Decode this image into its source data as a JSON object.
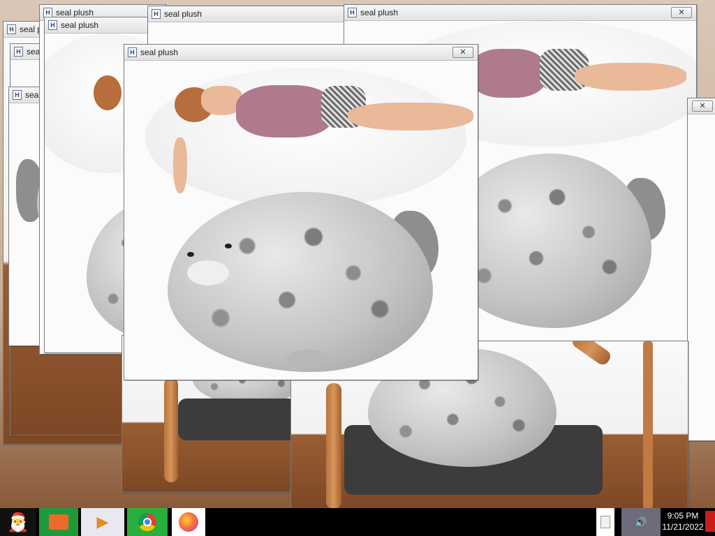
{
  "windows": [
    {
      "title": "seal plush",
      "close": "✕"
    },
    {
      "title": "seal plush",
      "close": "✕"
    },
    {
      "title": "seal plush",
      "close": "✕"
    },
    {
      "title": "seal plush",
      "close": "✕"
    },
    {
      "title": "seal plush",
      "close": "✕"
    },
    {
      "title": "seal plush",
      "close": "✕"
    },
    {
      "title": "seal plush",
      "close": "✕"
    },
    {
      "title": "seal plush",
      "close": "✕"
    },
    {
      "title": "seal plush",
      "close": "✕"
    }
  ],
  "app_icon_letter": "H",
  "taskbar": {
    "items": [
      {
        "icon": "santa-start-icon"
      },
      {
        "icon": "file-manager-icon"
      },
      {
        "icon": "media-player-icon"
      },
      {
        "icon": "chrome-icon"
      },
      {
        "icon": "firefox-icon"
      }
    ],
    "tray": [
      {
        "icon": "document-icon"
      },
      {
        "icon": "network-volume-icon",
        "glyph": "🔊"
      }
    ],
    "clock": {
      "time": "9:05 PM",
      "date": "11/21/2022"
    }
  },
  "colors": {
    "taskbar_bg": "#000000",
    "titlebar_top": "#f7f7f7",
    "titlebar_bottom": "#e2e2e2"
  }
}
